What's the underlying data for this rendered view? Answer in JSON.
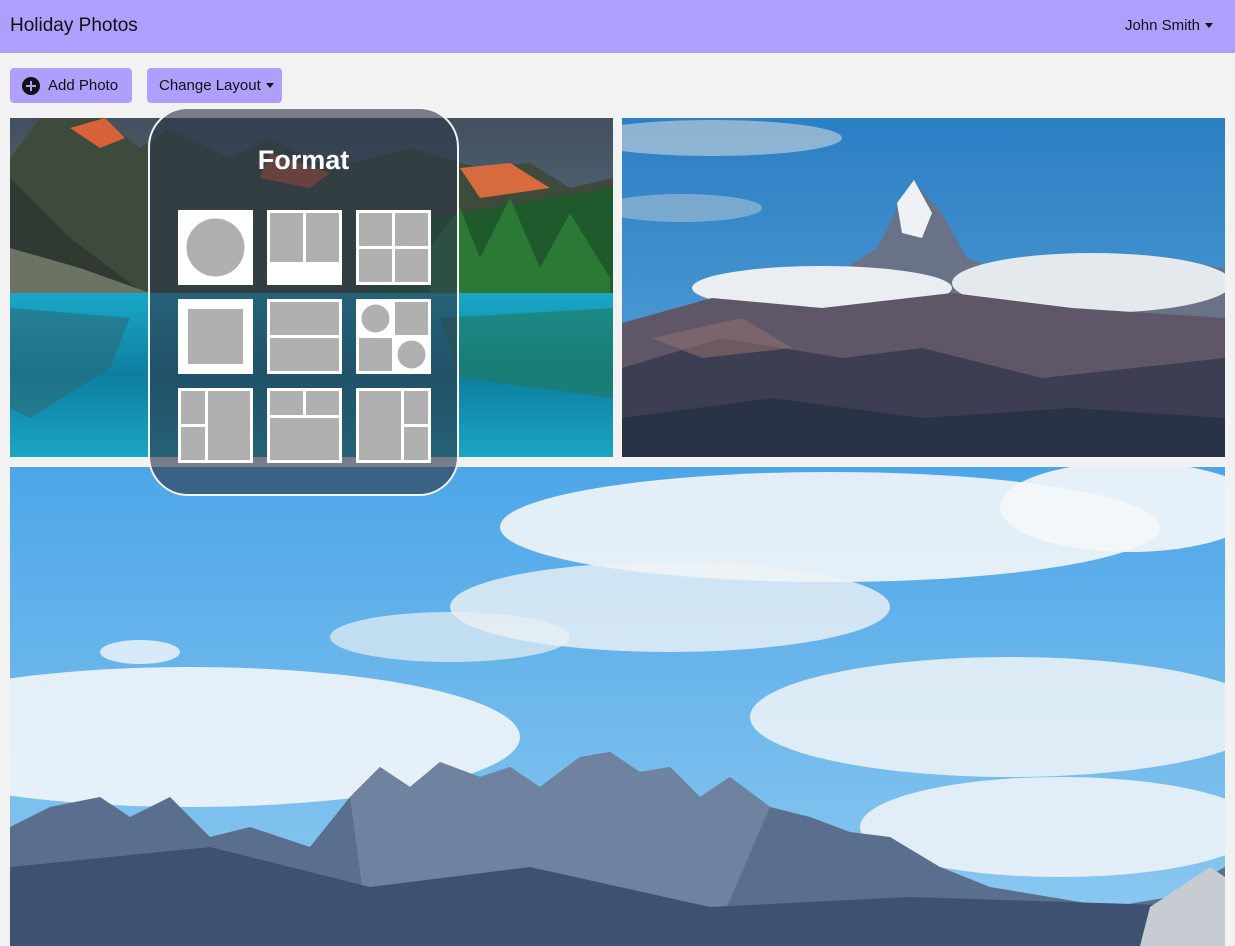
{
  "header": {
    "app_title": "Holiday Photos",
    "user_name": "John Smith"
  },
  "toolbar": {
    "add_photo_label": "Add Photo",
    "change_layout_label": "Change Layout"
  },
  "format_panel": {
    "title": "Format",
    "layouts": [
      "circle",
      "two-columns-with-bottom-margin",
      "four-grid",
      "single-square",
      "two-rows",
      "circles-and-squares-grid",
      "left-split-right-tall",
      "top-split-bottom-wide",
      "left-tall-right-split"
    ]
  },
  "photos": [
    "lake-mountains",
    "snowy-peak",
    "rocky-range-sky"
  ],
  "colors": {
    "accent": "#b19ffd",
    "background": "#f2f2f2",
    "layout_tile": "#b0b0b0"
  }
}
